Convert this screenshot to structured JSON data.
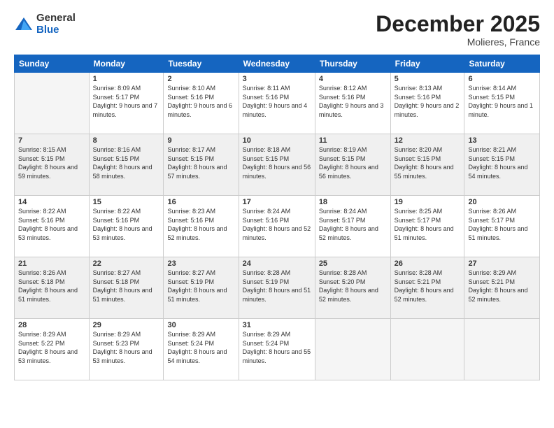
{
  "logo": {
    "general": "General",
    "blue": "Blue"
  },
  "title": "December 2025",
  "location": "Molieres, France",
  "days_header": [
    "Sunday",
    "Monday",
    "Tuesday",
    "Wednesday",
    "Thursday",
    "Friday",
    "Saturday"
  ],
  "weeks": [
    [
      {
        "day": "",
        "sunrise": "",
        "sunset": "",
        "daylight": ""
      },
      {
        "day": "1",
        "sunrise": "Sunrise: 8:09 AM",
        "sunset": "Sunset: 5:17 PM",
        "daylight": "Daylight: 9 hours and 7 minutes."
      },
      {
        "day": "2",
        "sunrise": "Sunrise: 8:10 AM",
        "sunset": "Sunset: 5:16 PM",
        "daylight": "Daylight: 9 hours and 6 minutes."
      },
      {
        "day": "3",
        "sunrise": "Sunrise: 8:11 AM",
        "sunset": "Sunset: 5:16 PM",
        "daylight": "Daylight: 9 hours and 4 minutes."
      },
      {
        "day": "4",
        "sunrise": "Sunrise: 8:12 AM",
        "sunset": "Sunset: 5:16 PM",
        "daylight": "Daylight: 9 hours and 3 minutes."
      },
      {
        "day": "5",
        "sunrise": "Sunrise: 8:13 AM",
        "sunset": "Sunset: 5:16 PM",
        "daylight": "Daylight: 9 hours and 2 minutes."
      },
      {
        "day": "6",
        "sunrise": "Sunrise: 8:14 AM",
        "sunset": "Sunset: 5:15 PM",
        "daylight": "Daylight: 9 hours and 1 minute."
      }
    ],
    [
      {
        "day": "7",
        "sunrise": "Sunrise: 8:15 AM",
        "sunset": "Sunset: 5:15 PM",
        "daylight": "Daylight: 8 hours and 59 minutes."
      },
      {
        "day": "8",
        "sunrise": "Sunrise: 8:16 AM",
        "sunset": "Sunset: 5:15 PM",
        "daylight": "Daylight: 8 hours and 58 minutes."
      },
      {
        "day": "9",
        "sunrise": "Sunrise: 8:17 AM",
        "sunset": "Sunset: 5:15 PM",
        "daylight": "Daylight: 8 hours and 57 minutes."
      },
      {
        "day": "10",
        "sunrise": "Sunrise: 8:18 AM",
        "sunset": "Sunset: 5:15 PM",
        "daylight": "Daylight: 8 hours and 56 minutes."
      },
      {
        "day": "11",
        "sunrise": "Sunrise: 8:19 AM",
        "sunset": "Sunset: 5:15 PM",
        "daylight": "Daylight: 8 hours and 56 minutes."
      },
      {
        "day": "12",
        "sunrise": "Sunrise: 8:20 AM",
        "sunset": "Sunset: 5:15 PM",
        "daylight": "Daylight: 8 hours and 55 minutes."
      },
      {
        "day": "13",
        "sunrise": "Sunrise: 8:21 AM",
        "sunset": "Sunset: 5:15 PM",
        "daylight": "Daylight: 8 hours and 54 minutes."
      }
    ],
    [
      {
        "day": "14",
        "sunrise": "Sunrise: 8:22 AM",
        "sunset": "Sunset: 5:16 PM",
        "daylight": "Daylight: 8 hours and 53 minutes."
      },
      {
        "day": "15",
        "sunrise": "Sunrise: 8:22 AM",
        "sunset": "Sunset: 5:16 PM",
        "daylight": "Daylight: 8 hours and 53 minutes."
      },
      {
        "day": "16",
        "sunrise": "Sunrise: 8:23 AM",
        "sunset": "Sunset: 5:16 PM",
        "daylight": "Daylight: 8 hours and 52 minutes."
      },
      {
        "day": "17",
        "sunrise": "Sunrise: 8:24 AM",
        "sunset": "Sunset: 5:16 PM",
        "daylight": "Daylight: 8 hours and 52 minutes."
      },
      {
        "day": "18",
        "sunrise": "Sunrise: 8:24 AM",
        "sunset": "Sunset: 5:17 PM",
        "daylight": "Daylight: 8 hours and 52 minutes."
      },
      {
        "day": "19",
        "sunrise": "Sunrise: 8:25 AM",
        "sunset": "Sunset: 5:17 PM",
        "daylight": "Daylight: 8 hours and 51 minutes."
      },
      {
        "day": "20",
        "sunrise": "Sunrise: 8:26 AM",
        "sunset": "Sunset: 5:17 PM",
        "daylight": "Daylight: 8 hours and 51 minutes."
      }
    ],
    [
      {
        "day": "21",
        "sunrise": "Sunrise: 8:26 AM",
        "sunset": "Sunset: 5:18 PM",
        "daylight": "Daylight: 8 hours and 51 minutes."
      },
      {
        "day": "22",
        "sunrise": "Sunrise: 8:27 AM",
        "sunset": "Sunset: 5:18 PM",
        "daylight": "Daylight: 8 hours and 51 minutes."
      },
      {
        "day": "23",
        "sunrise": "Sunrise: 8:27 AM",
        "sunset": "Sunset: 5:19 PM",
        "daylight": "Daylight: 8 hours and 51 minutes."
      },
      {
        "day": "24",
        "sunrise": "Sunrise: 8:28 AM",
        "sunset": "Sunset: 5:19 PM",
        "daylight": "Daylight: 8 hours and 51 minutes."
      },
      {
        "day": "25",
        "sunrise": "Sunrise: 8:28 AM",
        "sunset": "Sunset: 5:20 PM",
        "daylight": "Daylight: 8 hours and 52 minutes."
      },
      {
        "day": "26",
        "sunrise": "Sunrise: 8:28 AM",
        "sunset": "Sunset: 5:21 PM",
        "daylight": "Daylight: 8 hours and 52 minutes."
      },
      {
        "day": "27",
        "sunrise": "Sunrise: 8:29 AM",
        "sunset": "Sunset: 5:21 PM",
        "daylight": "Daylight: 8 hours and 52 minutes."
      }
    ],
    [
      {
        "day": "28",
        "sunrise": "Sunrise: 8:29 AM",
        "sunset": "Sunset: 5:22 PM",
        "daylight": "Daylight: 8 hours and 53 minutes."
      },
      {
        "day": "29",
        "sunrise": "Sunrise: 8:29 AM",
        "sunset": "Sunset: 5:23 PM",
        "daylight": "Daylight: 8 hours and 53 minutes."
      },
      {
        "day": "30",
        "sunrise": "Sunrise: 8:29 AM",
        "sunset": "Sunset: 5:24 PM",
        "daylight": "Daylight: 8 hours and 54 minutes."
      },
      {
        "day": "31",
        "sunrise": "Sunrise: 8:29 AM",
        "sunset": "Sunset: 5:24 PM",
        "daylight": "Daylight: 8 hours and 55 minutes."
      },
      {
        "day": "",
        "sunrise": "",
        "sunset": "",
        "daylight": ""
      },
      {
        "day": "",
        "sunrise": "",
        "sunset": "",
        "daylight": ""
      },
      {
        "day": "",
        "sunrise": "",
        "sunset": "",
        "daylight": ""
      }
    ]
  ]
}
